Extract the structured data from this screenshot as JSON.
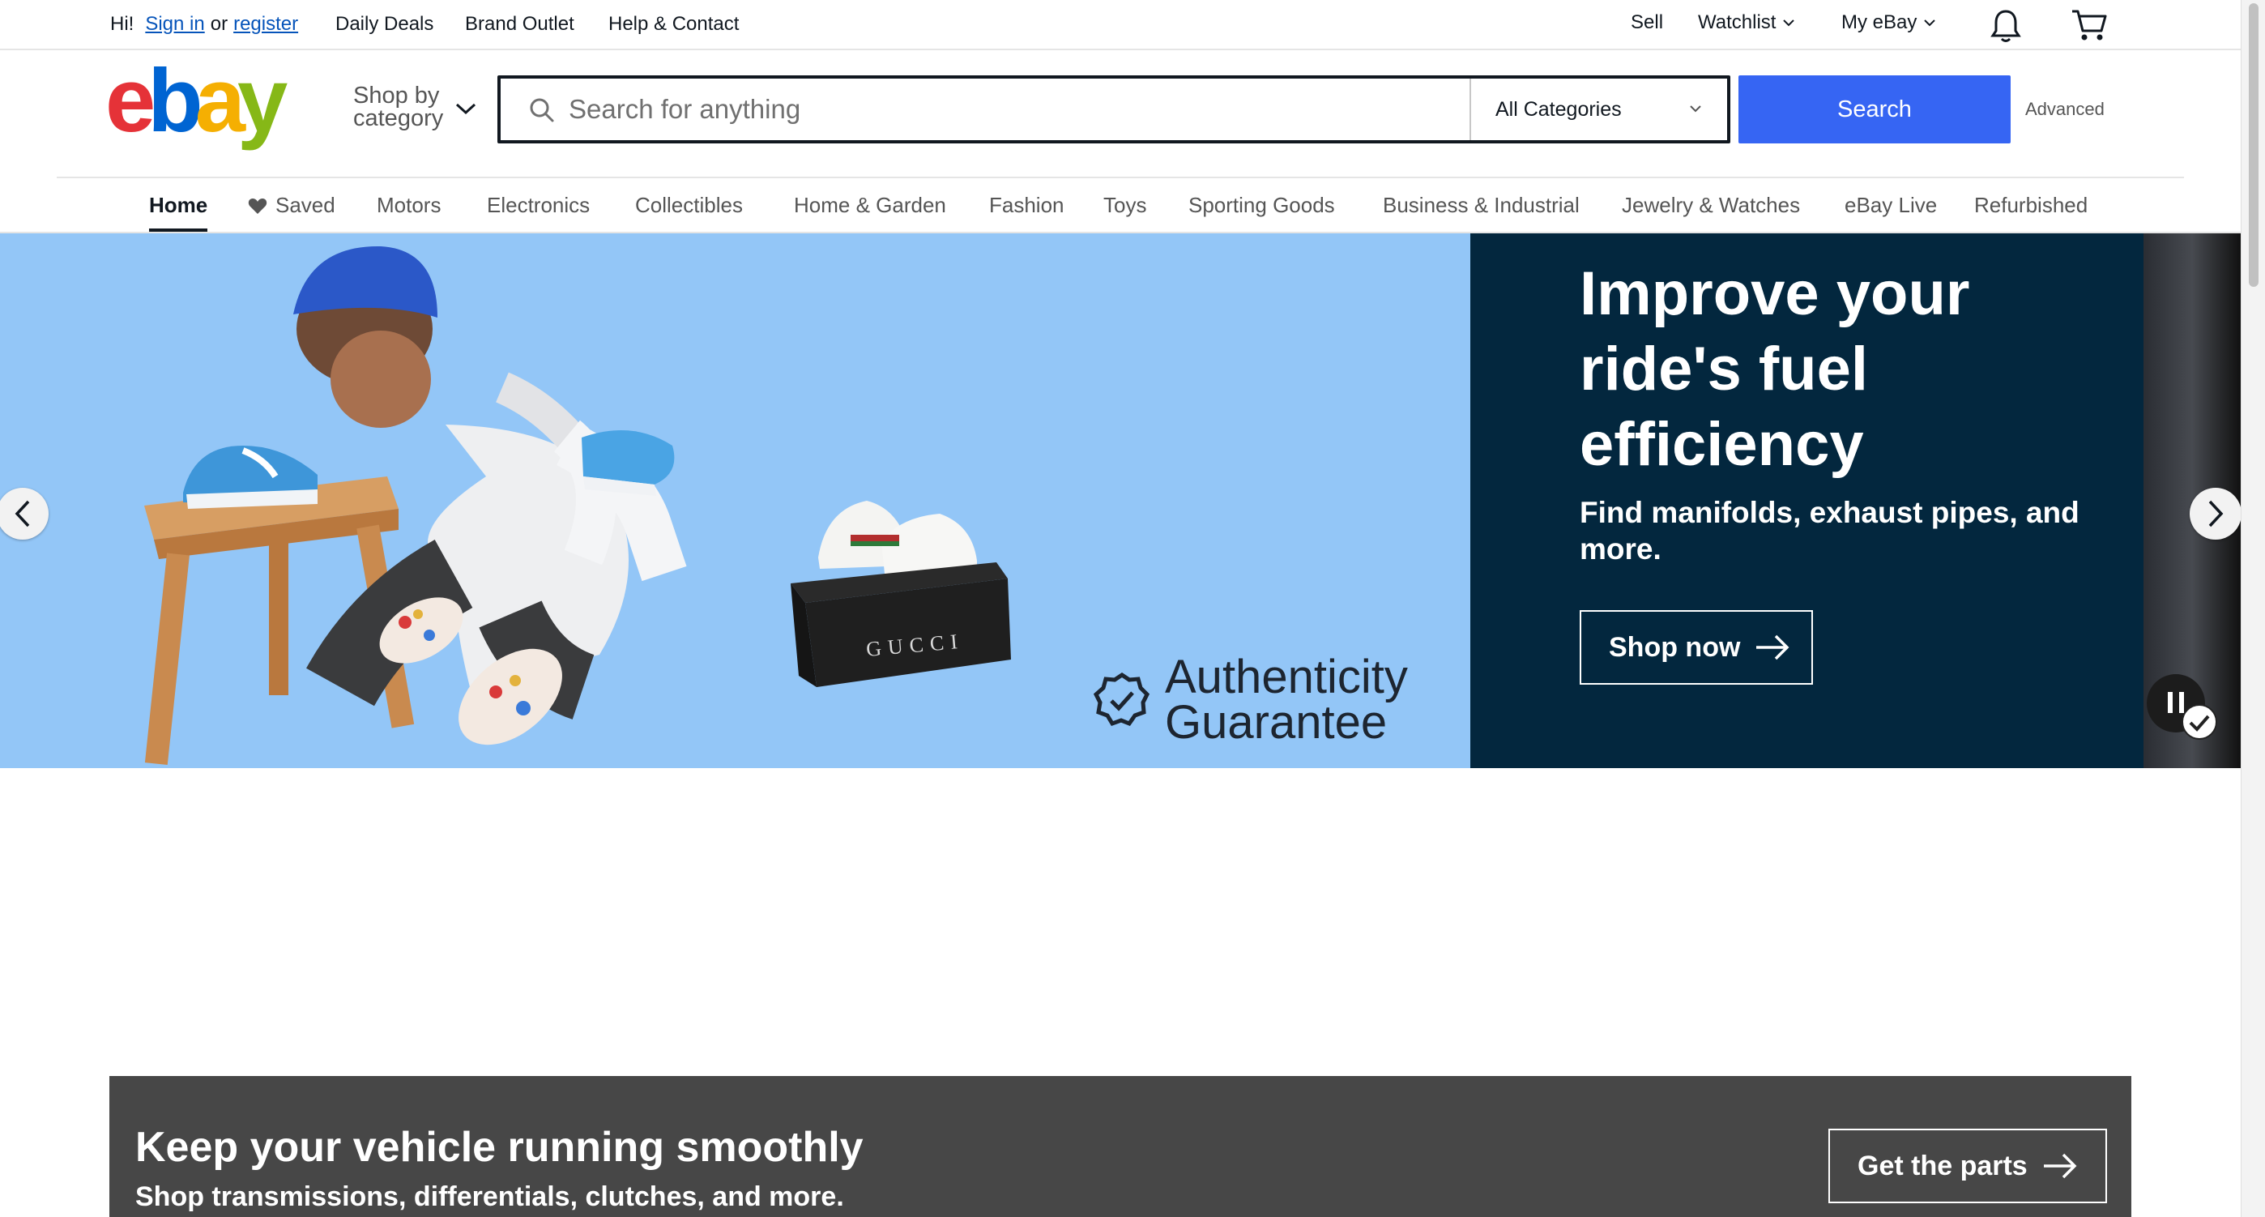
{
  "topbar": {
    "greeting": "Hi!",
    "sign_in": "Sign in",
    "or": "or",
    "register": "register",
    "links": [
      "Daily Deals",
      "Brand Outlet",
      "Help & Contact"
    ],
    "sell": "Sell",
    "watchlist": "Watchlist",
    "my_ebay": "My eBay"
  },
  "header": {
    "logo_letters": [
      "e",
      "b",
      "a",
      "y"
    ],
    "logo_colors": [
      "#e53238",
      "#0064d2",
      "#f5af02",
      "#86b817"
    ],
    "shop_by_line1": "Shop by",
    "shop_by_line2": "category",
    "search_placeholder": "Search for anything",
    "category_selected": "All Categories",
    "search_button": "Search",
    "advanced": "Advanced",
    "accent": "#3665f3"
  },
  "nav": {
    "items": [
      "Home",
      "Saved",
      "Motors",
      "Electronics",
      "Collectibles",
      "Home & Garden",
      "Fashion",
      "Toys",
      "Sporting Goods",
      "Business & Industrial",
      "Jewelry & Watches",
      "eBay Live",
      "Refurbished"
    ]
  },
  "hero": {
    "headline": "Improve your ride's fuel efficiency",
    "subtext": "Find manifolds, exhaust pipes, and more.",
    "cta": "Shop now",
    "badge_line1": "Authenticity",
    "badge_line2": "Guarantee",
    "box_brand": "GUCCI",
    "left_bg": "#93c6f7",
    "right_bg": "#03273e"
  },
  "banner": {
    "title": "Keep your vehicle running smoothly",
    "subtitle": "Shop transmissions, differentials, clutches, and more.",
    "cta": "Get the parts",
    "bg": "#474747"
  }
}
